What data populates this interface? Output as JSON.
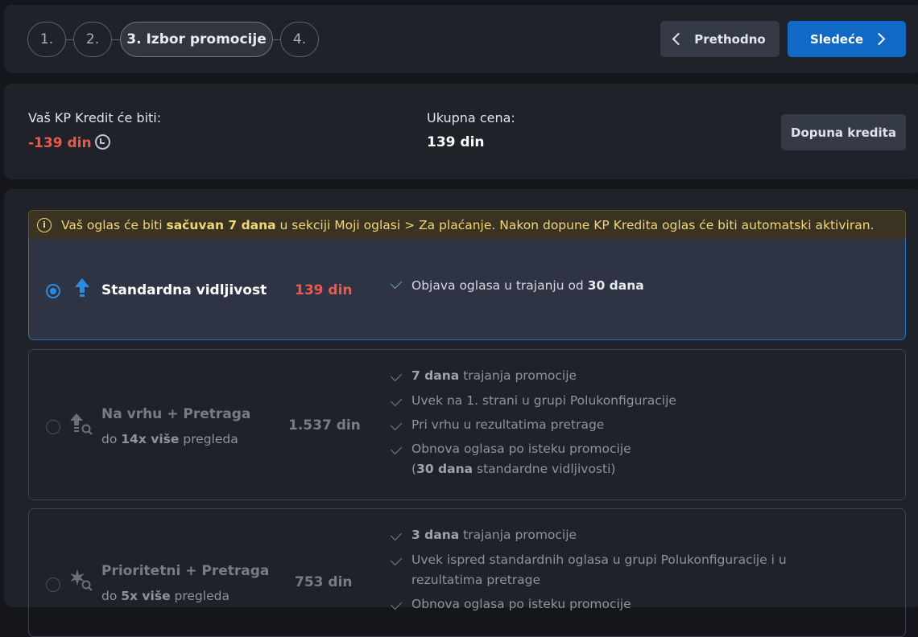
{
  "steps": {
    "s1": "1.",
    "s2": "2.",
    "s3": "3. Izbor promocije",
    "s4": "4."
  },
  "nav": {
    "prev": "Prethodno",
    "next": "Sledeće"
  },
  "credit": {
    "label": "Vaš KP Kredit će biti:",
    "value": "-139 din",
    "total_label": "Ukupna cena:",
    "total_value": "139 din",
    "topup": "Dopuna kredita"
  },
  "notice": {
    "pre": "Vaš oglas će biti ",
    "bold": "sačuvan 7 dana",
    "post": " u sekciji Moji oglasi > Za plaćanje. Nakon dopune KP Kredita oglas će biti automatski aktiviran."
  },
  "options": [
    {
      "title": "Standardna vidljivost",
      "price": "139 din",
      "selected": true,
      "features": [
        {
          "pre": "Objava oglasa u trajanju od ",
          "bold": "30 dana",
          "post": ""
        }
      ]
    },
    {
      "title": "Na vrhu + Pretraga",
      "sub_pre": "do ",
      "sub_bold": "14x više",
      "sub_post": " pregleda",
      "price": "1.537 din",
      "selected": false,
      "features": [
        {
          "pre": "",
          "bold": "7 dana",
          "post": " trajanja promocije"
        },
        {
          "pre": "Uvek na 1. strani u grupi Polukonfiguracije",
          "bold": "",
          "post": ""
        },
        {
          "pre": "Pri vrhu u rezultatima pretrage",
          "bold": "",
          "post": ""
        },
        {
          "pre": "Obnova oglasa po isteku promocije",
          "bold": "",
          "post": ""
        },
        {
          "pre": "(",
          "bold": "30 dana",
          "post": " standardne vidljivosti)"
        }
      ]
    },
    {
      "title": "Prioritetni + Pretraga",
      "sub_pre": "do ",
      "sub_bold": "5x više",
      "sub_post": " pregleda",
      "price": "753 din",
      "selected": false,
      "features": [
        {
          "pre": "",
          "bold": "3 dana",
          "post": " trajanja promocije"
        },
        {
          "pre": "Uvek ispred standardnih oglasa u grupi Polukonfiguracije i u",
          "bold": "",
          "post": ""
        },
        {
          "pre": "rezultatima pretrage",
          "bold": "",
          "post": ""
        },
        {
          "pre": "Obnova oglasa po isteku promocije",
          "bold": "",
          "post": ""
        }
      ]
    }
  ],
  "colors": {
    "accent": "#1069c4",
    "negative": "#f0584a",
    "notice": "#f0d67a"
  }
}
